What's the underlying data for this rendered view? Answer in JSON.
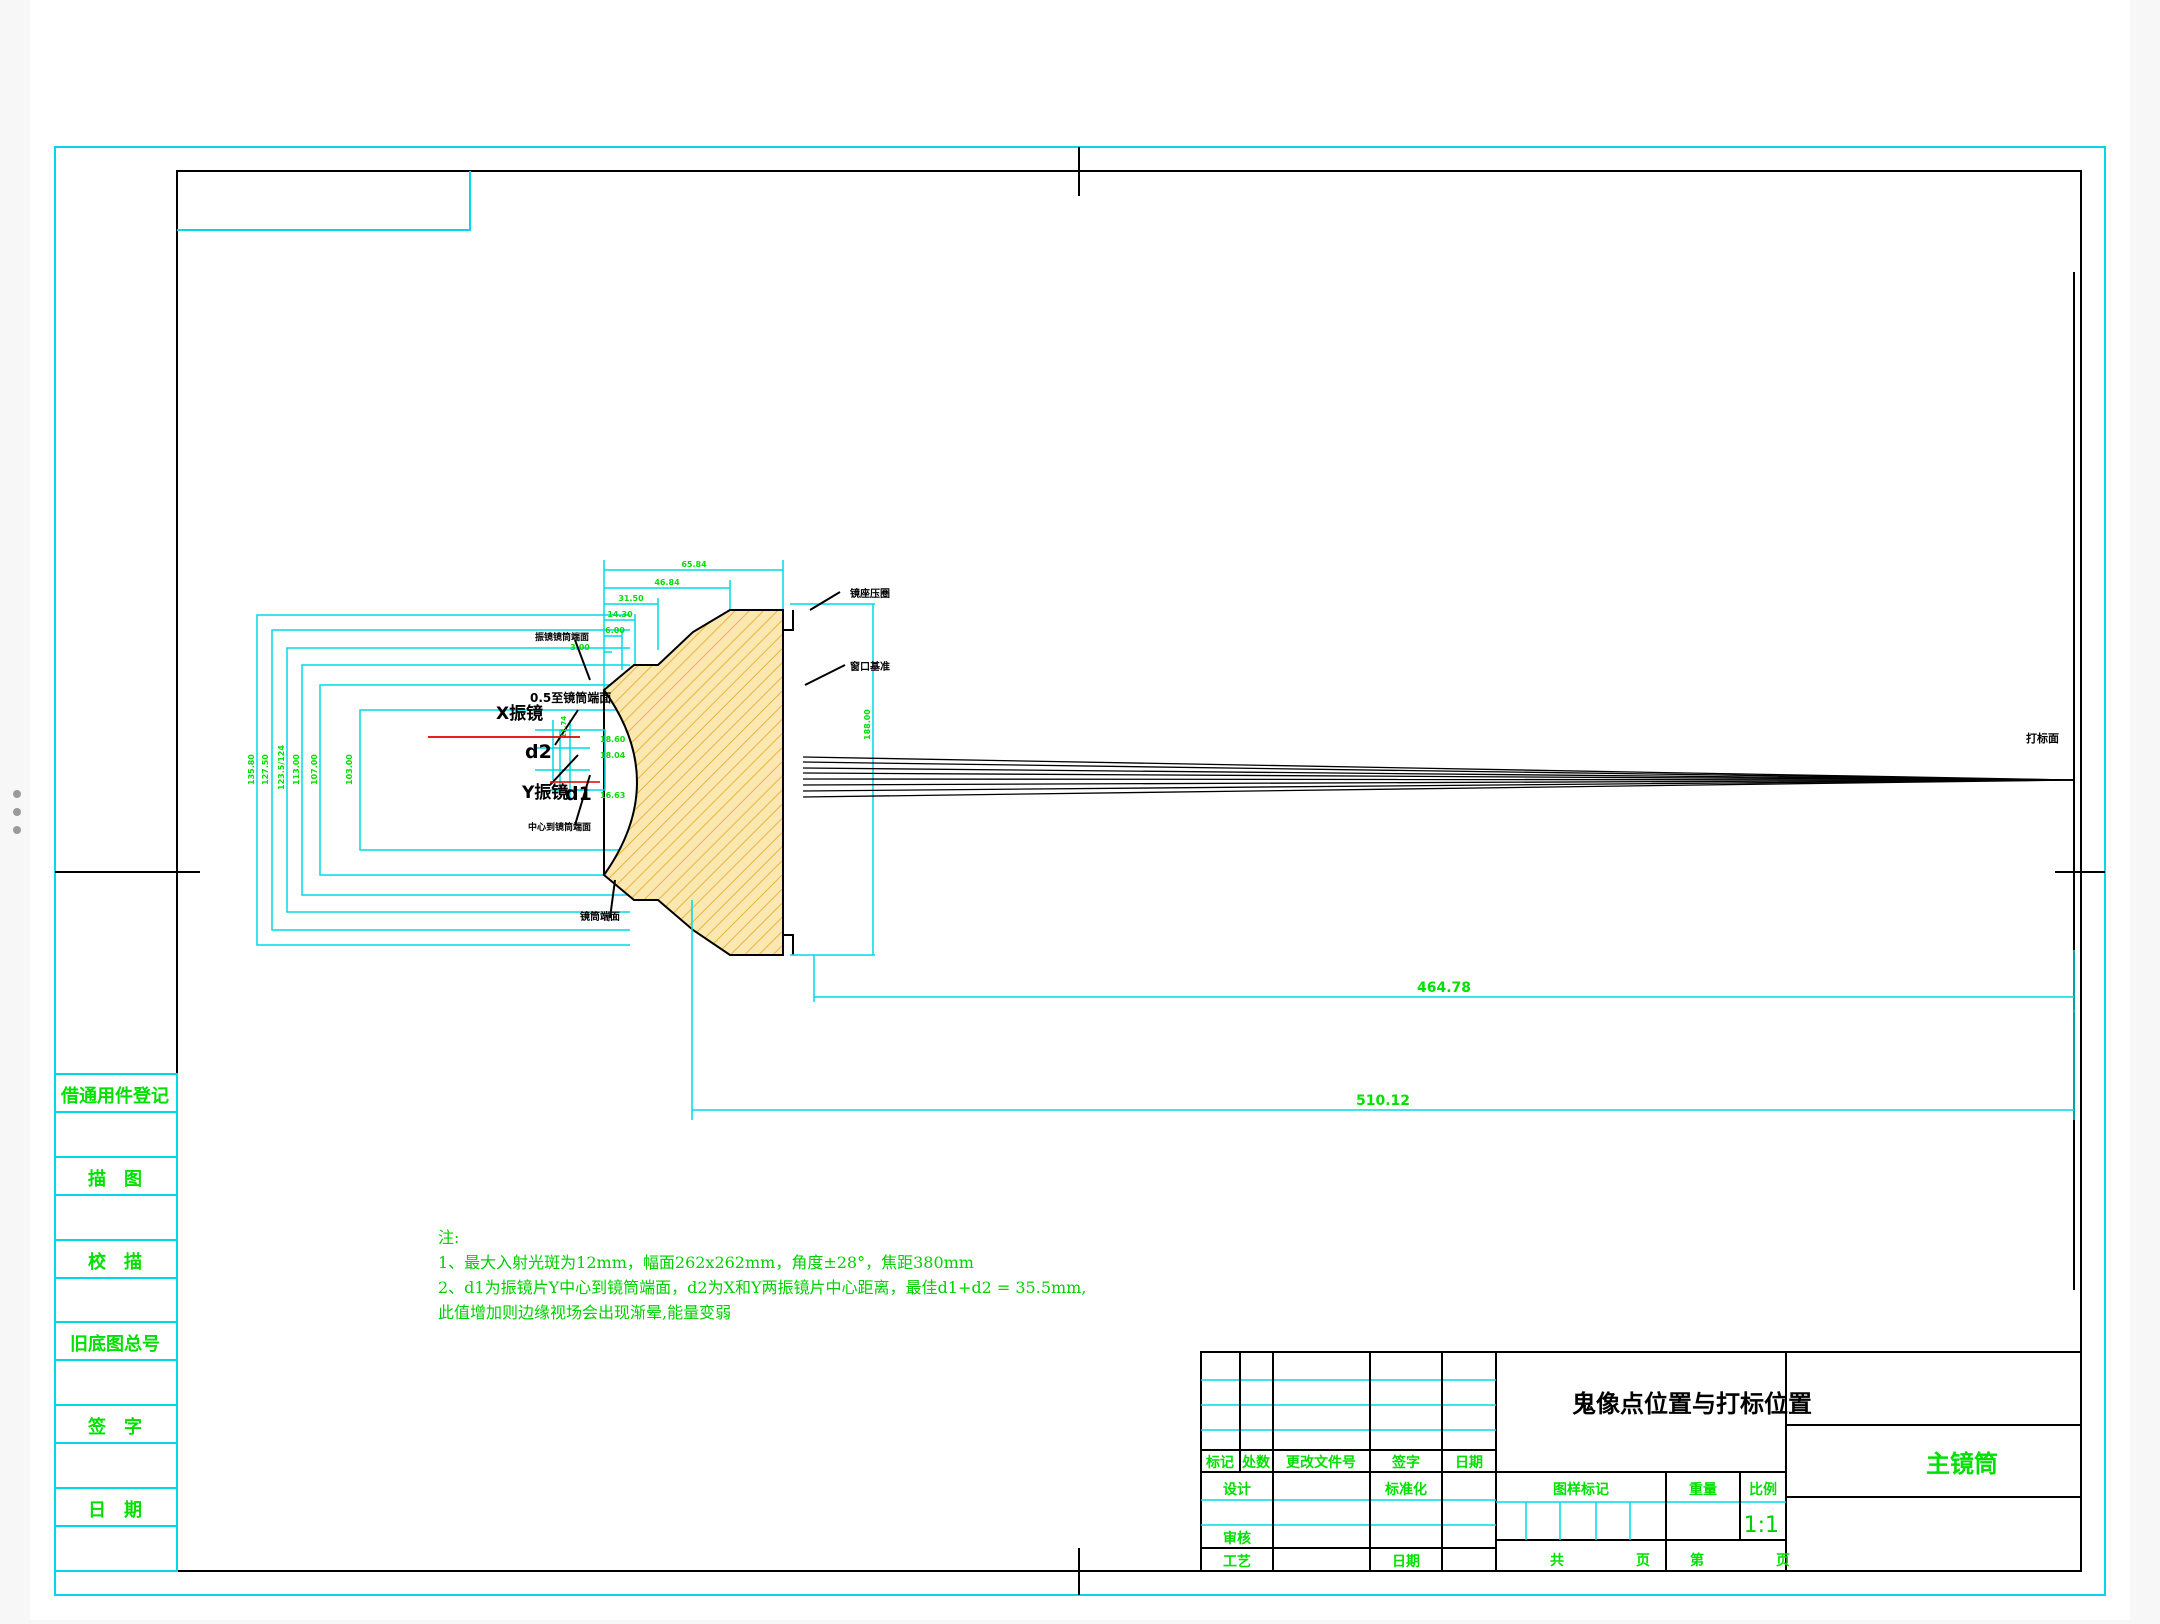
{
  "drawing": {
    "title": "鬼像点位置与打标位置",
    "part_name": "主镜筒",
    "scale": "1:1"
  },
  "notes": {
    "heading": "注:",
    "line1": "1、最大入射光斑为12mm，幅面262x262mm，角度±28°，焦距380mm",
    "line2": "2、d1为振镜片Y中心到镜筒端面，d2为X和Y两振镜片中心距离，最佳d1+d2 = 35.5mm,",
    "line3": "此值增加则边缘视场会出现渐晕,能量变弱"
  },
  "dimensions": {
    "d464": "464.78",
    "d510": "510.12",
    "top1": "65.84",
    "top2": "46.84",
    "top3": "31.50",
    "top4": "14.30",
    "top5": "6.00",
    "top6": "3.00",
    "vert1": "18.60",
    "vert2": "18.04",
    "vert3": "16.63",
    "vert4": "11.74",
    "right": "188.00",
    "left1": "135.80",
    "left2": "127.50",
    "left3": "123.5/124",
    "left4": "113.00",
    "left5": "107.00",
    "left6": "103.00"
  },
  "labels": {
    "x_mirror": "X振镜",
    "y_mirror": "Y振镜",
    "d2": "d2",
    "d1": "d1",
    "dist_05": "0.5至镜筒端面",
    "mirror_face": "振镜镜筒端面",
    "center_dist": "中心到镜筒端面",
    "barrel_end": "镜筒端面",
    "lens_holder": "镜座压圈",
    "window": "窗口基准",
    "marking_plane": "打标面"
  },
  "side_block": {
    "r1": "借通用件登记",
    "r2": "描　图",
    "r3": "校　描",
    "r4": "旧底图总号",
    "r5": "签　字",
    "r6": "日　期"
  },
  "title_block": {
    "mark": "标记",
    "count": "处数",
    "change_doc": "更改文件号",
    "sign": "签字",
    "date": "日期",
    "design": "设计",
    "standard": "标准化",
    "review": "审核",
    "process": "工艺",
    "date2": "日期",
    "stage_mark": "图样标记",
    "weight": "重量",
    "ratio": "比例",
    "total": "共",
    "sheet": "页",
    "page_no": "第",
    "page": "页"
  },
  "colors": {
    "frame": "#00d8e6",
    "outline": "#000000",
    "text": "#00e000",
    "hatch": "#f2cf6a",
    "ray_center": "#e00000"
  }
}
